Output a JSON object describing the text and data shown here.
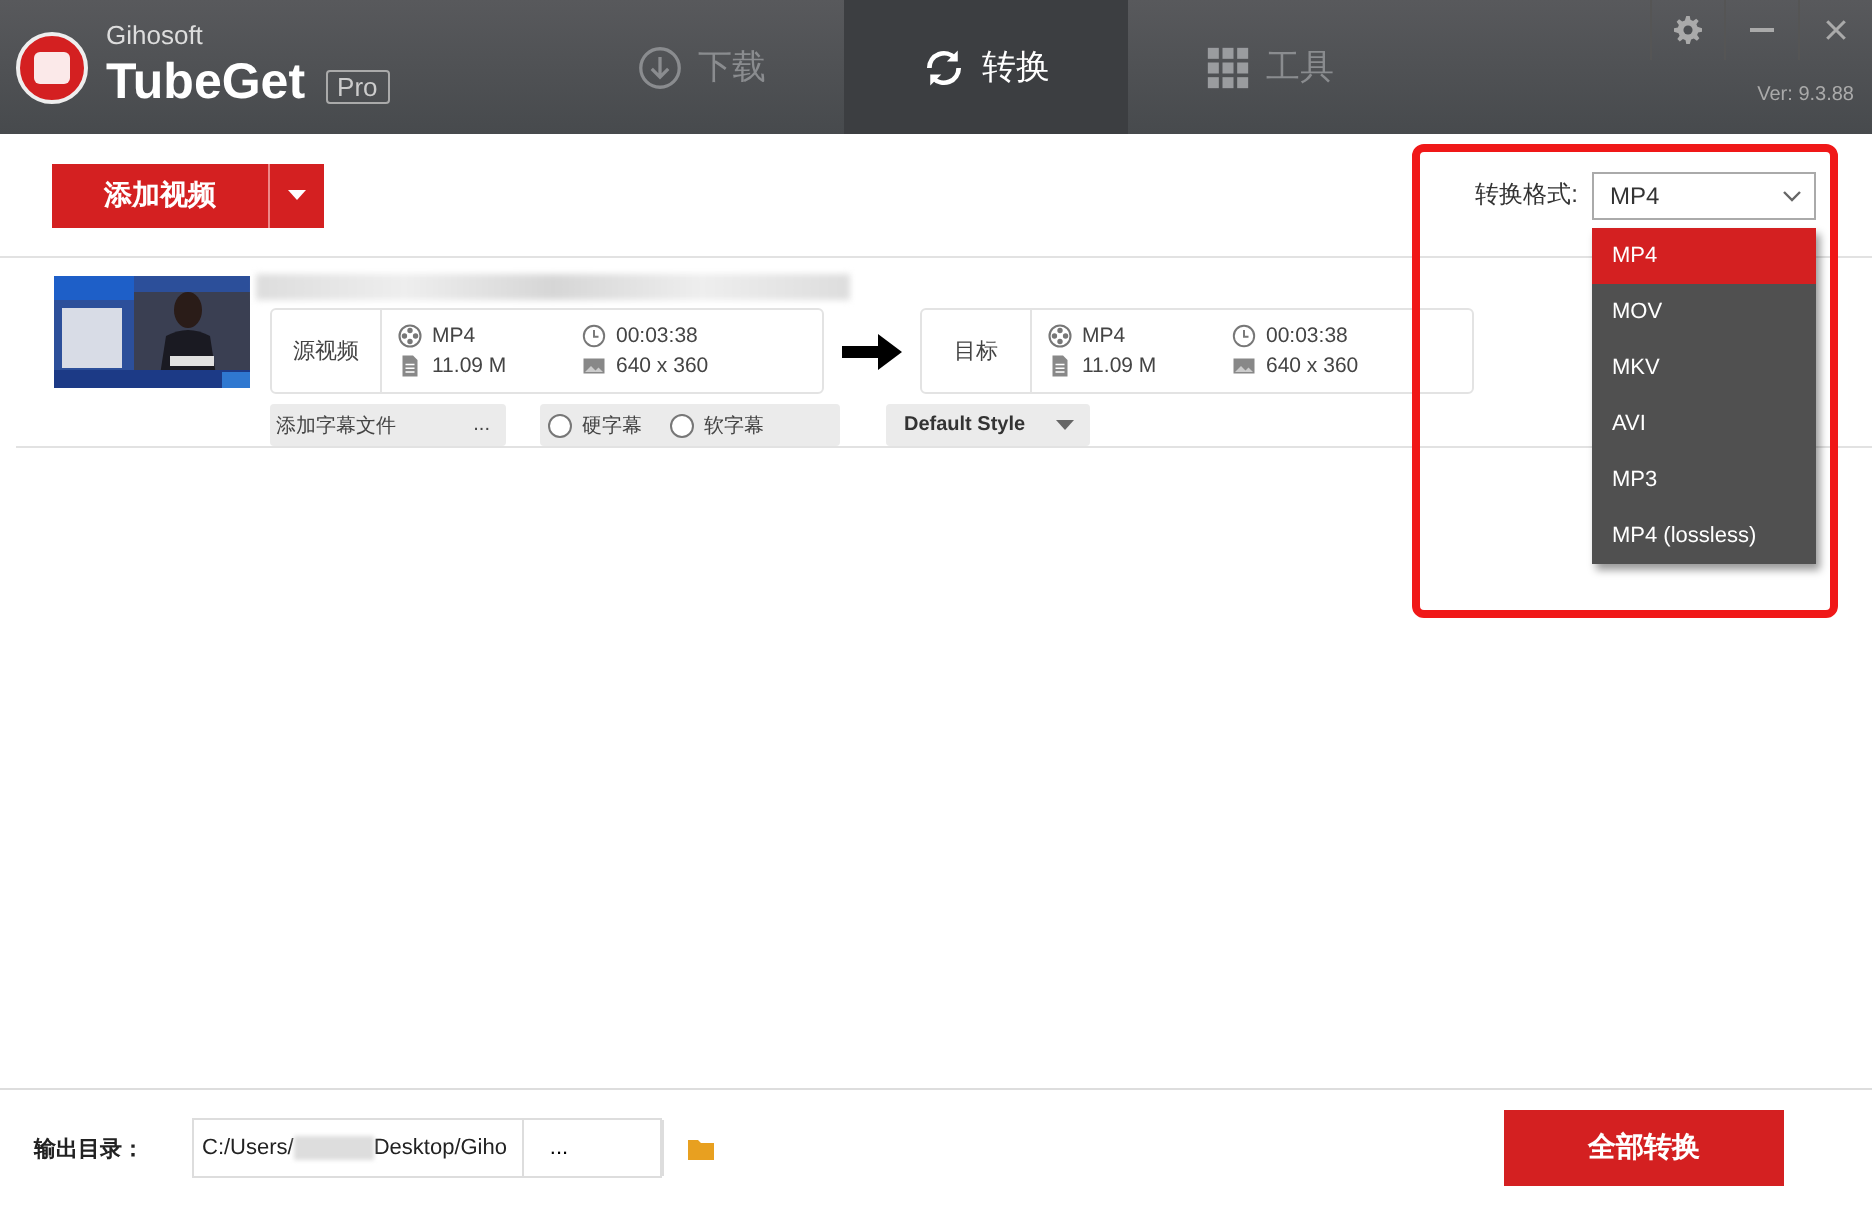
{
  "app": {
    "vendor": "Gihosoft",
    "name": "TubeGet",
    "edition": "Pro",
    "version": "Ver: 9.3.88"
  },
  "tabs": [
    {
      "label": "下载",
      "selected": false
    },
    {
      "label": "转换",
      "selected": true
    },
    {
      "label": "工具",
      "selected": false
    }
  ],
  "window_controls": [
    {
      "kind": "settings"
    },
    {
      "kind": "minimize"
    },
    {
      "kind": "close"
    }
  ],
  "toolbar": {
    "add_button": "添加视频",
    "format_label": "转换格式:",
    "format_value": "MP4"
  },
  "format_menu": [
    {
      "label": "MP4",
      "selected": true
    },
    {
      "label": "MOV",
      "selected": false
    },
    {
      "label": "MKV",
      "selected": false
    },
    {
      "label": "AVI",
      "selected": false
    },
    {
      "label": "MP3",
      "selected": false
    },
    {
      "label": "MP4 (lossless)",
      "selected": false
    }
  ],
  "items": [
    {
      "thumbnail": {
        "kind": "picture"
      },
      "source": {
        "label": "源视频",
        "format": "MP4",
        "duration": "00:03:38",
        "size": "11.09 M",
        "resolution": "640 x 360"
      },
      "target": {
        "label": "目标",
        "format": "MP4",
        "duration": "00:03:38",
        "size": "11.09 M",
        "resolution": "640 x 360"
      },
      "subtitle_file": "添加字幕文件",
      "subtitle_browse": "...",
      "subtitle_options": [
        {
          "label": "硬字幕",
          "selected": false
        },
        {
          "label": "软字幕",
          "selected": false
        }
      ],
      "style": "Default Style"
    }
  ],
  "output": {
    "label": "输出目录：",
    "path_start": "C:/Users/",
    "path_end": "Desktop/Giho",
    "browse": "..."
  },
  "convert_all": "全部转换"
}
